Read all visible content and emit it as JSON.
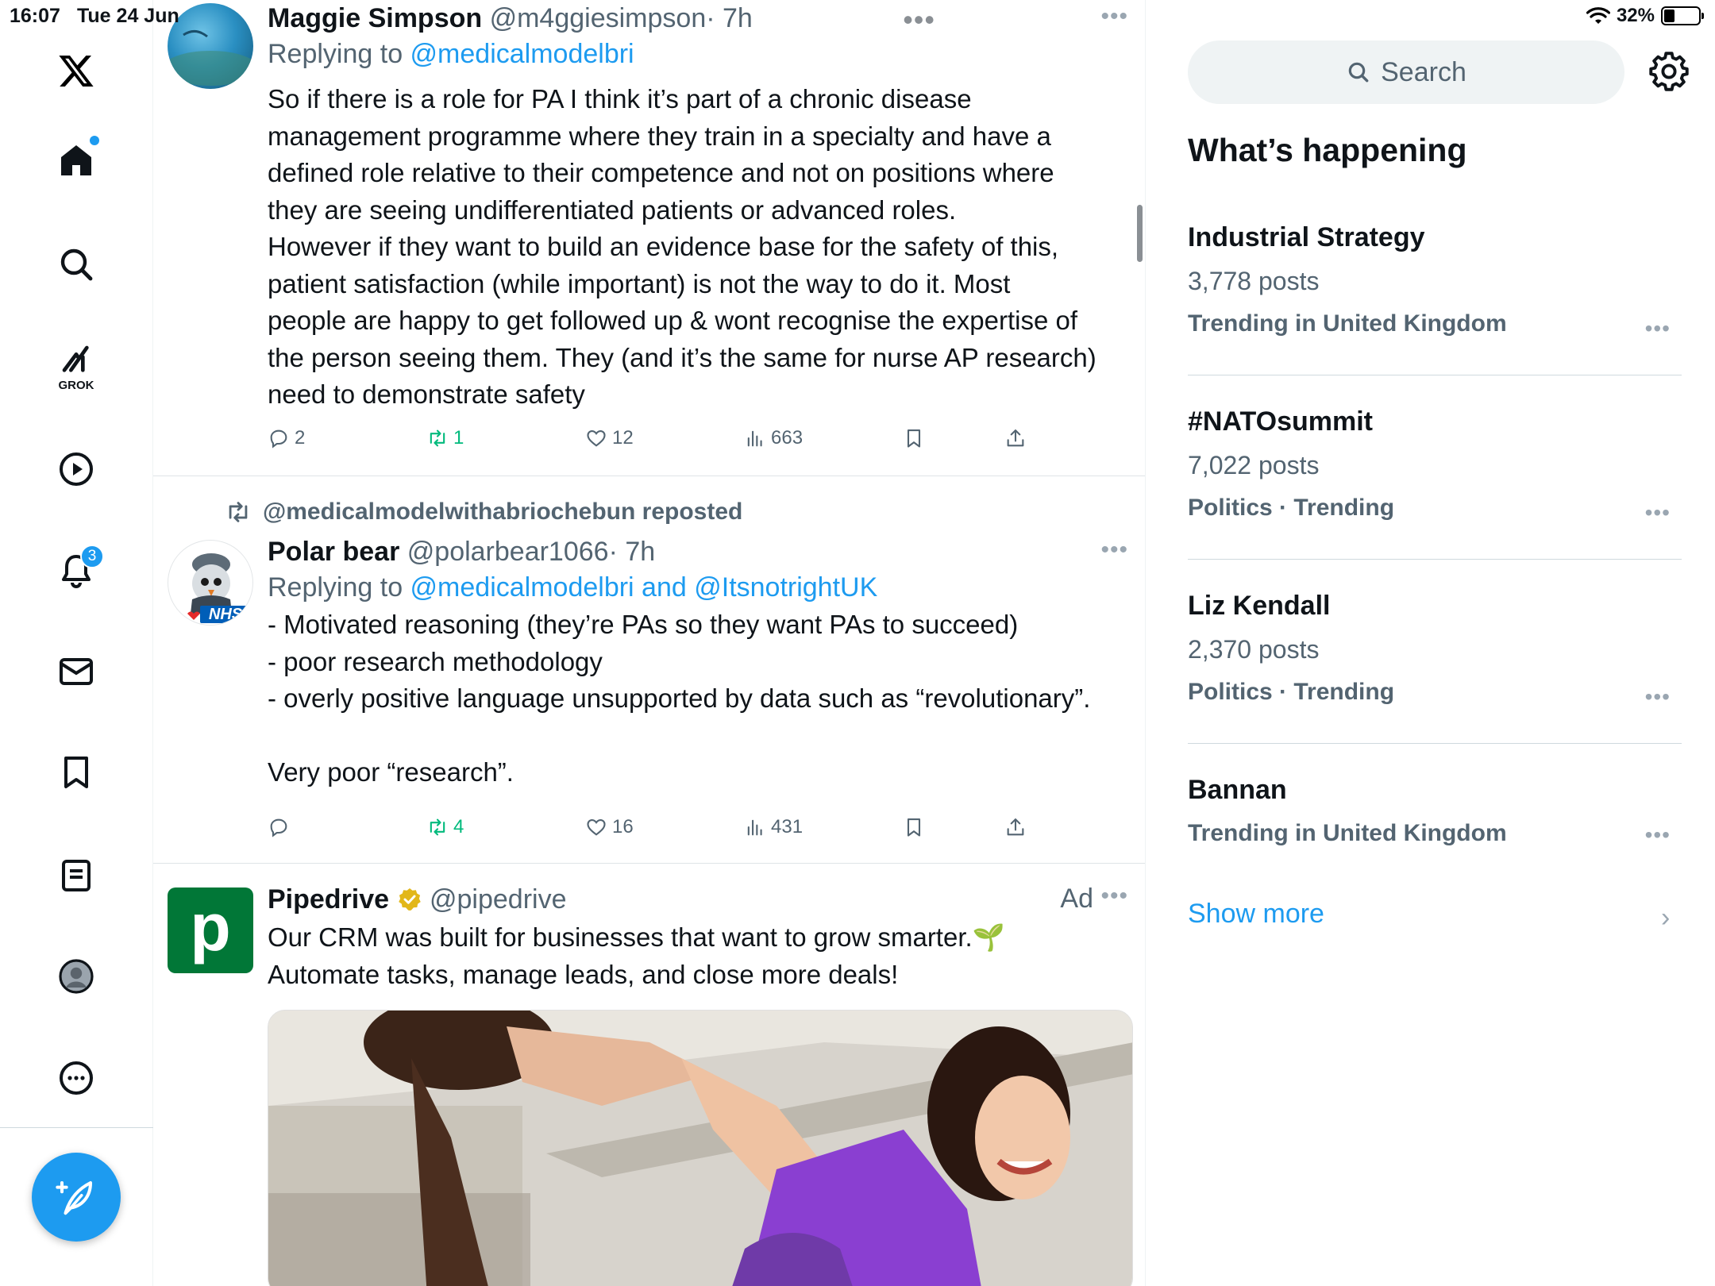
{
  "status_bar": {
    "time": "16:07",
    "date": "Tue 24 Jun",
    "battery": "32%",
    "battery_level": 0.32
  },
  "nav": {
    "items": [
      "x-logo",
      "home",
      "explore",
      "grok",
      "video",
      "notifications",
      "messages",
      "bookmarks",
      "lists",
      "profile",
      "more"
    ],
    "grok_label": "GROK",
    "notifications_badge": "3",
    "icons": {
      "home": "home-icon",
      "search": "search-icon",
      "grok": "grok-icon",
      "video": "play-icon",
      "notifications": "bell-icon",
      "messages": "envelope-icon",
      "bookmarks": "bookmark-icon",
      "lists": "list-icon",
      "profile": "avatar-icon",
      "more": "more-circle-icon",
      "compose": "feather-plus-icon"
    }
  },
  "colors": {
    "accent": "#1d9bf0",
    "repost_green": "#00ba7c",
    "secondary_text": "#536471",
    "pipedrive_green": "#017737",
    "verified_gold": "#e2b719"
  },
  "tweets": [
    {
      "name": "Maggie Simpson",
      "handle": "@m4ggiesimpson",
      "time": "· 7h",
      "replying_prefix": "Replying to ",
      "replying_to": "@medicalmodelbri",
      "text": "So if there is a role for PA I think it’s part of a chronic disease\nmanagement programme where they train in a specialty and have a\ndefined role relative to their competence and not on positions where\nthey are seeing undifferentiated patients or advanced roles.\nHowever if they want to build an evidence base for the safety of this,\npatient satisfaction (while important) is not the way to do it. Most\npeople are happy to get followed up & wont recognise the expertise of\nthe person seeing them. They (and it’s the same for nurse AP research)\nneed to demonstrate safety",
      "replies": "2",
      "reposts": "1",
      "likes": "12",
      "views": "663"
    },
    {
      "reposted_by": "@medicalmodelwithabriochebun reposted",
      "name": "Polar bear",
      "handle": "@polarbear1066",
      "time": "· 7h",
      "replying_prefix": "Replying to ",
      "replying_to": "@medicalmodelbri and @ItsnotrightUK",
      "avatar_text": "NHS",
      "text": "- Motivated reasoning (they’re PAs so they want PAs to succeed)\n- poor research methodology\n- overly positive language unsupported by data such as “revolutionary”.\n\nVery poor “research”.",
      "replies": "",
      "reposts": "4",
      "likes": "16",
      "views": "431"
    },
    {
      "name": "Pipedrive",
      "handle": "@pipedrive",
      "ad_label": "Ad",
      "avatar_letter": "p",
      "text": "Our CRM was built for businesses that want to grow smarter.🌱\nAutomate tasks, manage leads, and close more deals!"
    }
  ],
  "sidebar": {
    "search_placeholder": "Search",
    "section_title": "What’s happening",
    "trends": [
      {
        "name": "Industrial Strategy",
        "posts": "3,778 posts",
        "category": "Trending in United Kingdom"
      },
      {
        "name": "#NATOsummit",
        "posts": "7,022 posts",
        "category": "Politics · Trending"
      },
      {
        "name": "Liz Kendall",
        "posts": "2,370 posts",
        "category": "Politics · Trending"
      },
      {
        "name": "Bannan",
        "posts": "",
        "category": "Trending in United Kingdom"
      }
    ],
    "show_more": "Show more"
  }
}
